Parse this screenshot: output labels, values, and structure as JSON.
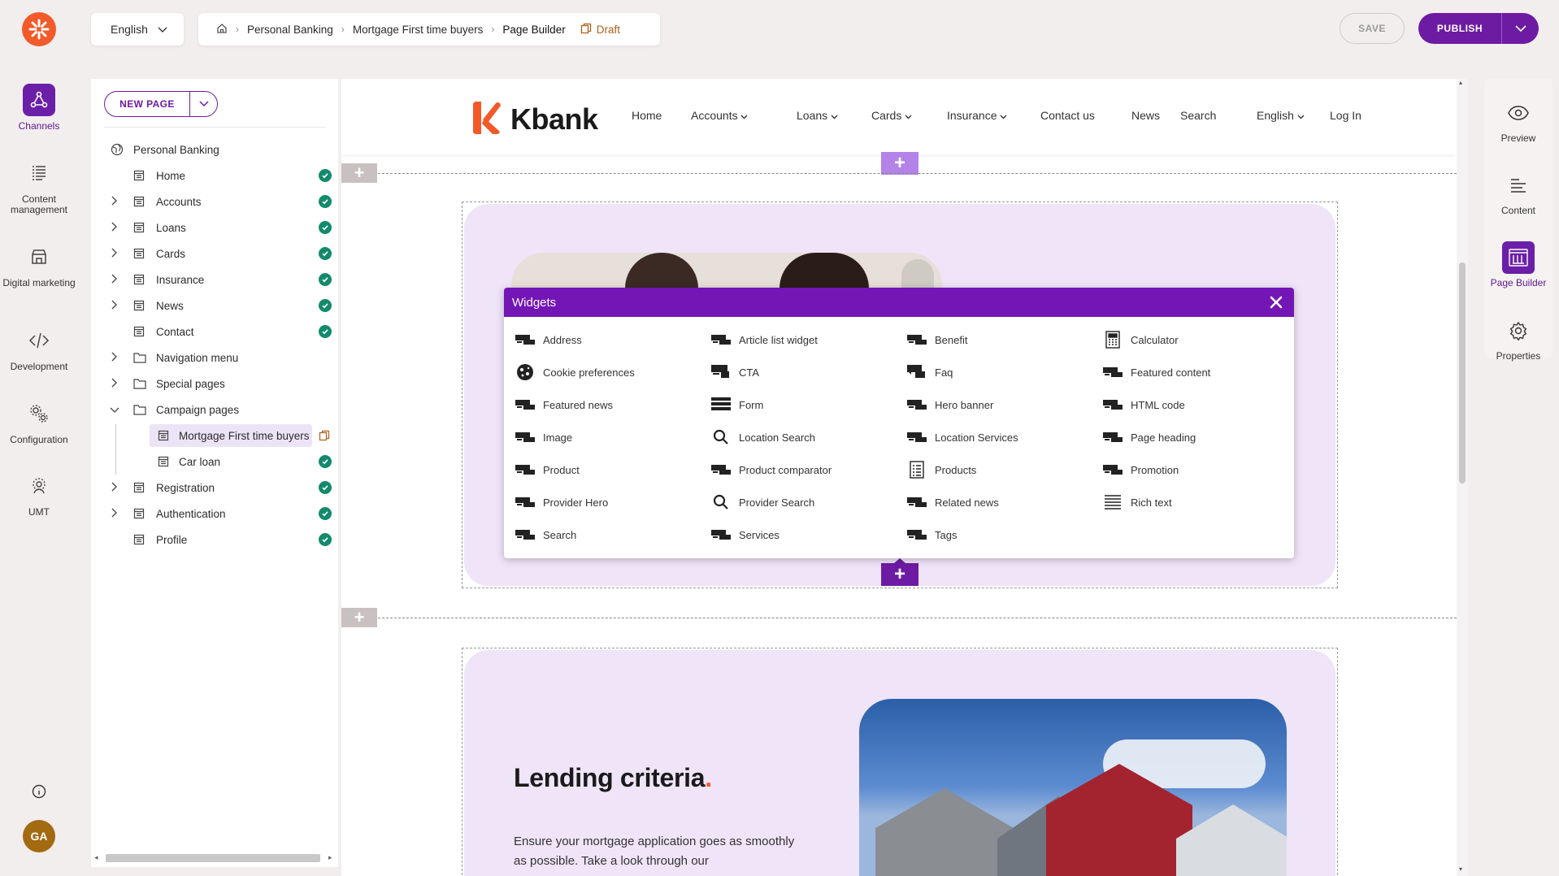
{
  "rail": {
    "items": [
      {
        "label": "Channels",
        "icon": "channels-icon",
        "active": true
      },
      {
        "label": "Content management",
        "icon": "content-management-icon"
      },
      {
        "label": "Digital marketing",
        "icon": "digital-marketing-icon"
      },
      {
        "label": "Development",
        "icon": "code-icon"
      },
      {
        "label": "Configuration",
        "icon": "gears-icon"
      },
      {
        "label": "UMT",
        "icon": "umt-icon"
      }
    ],
    "info_icon": "info-icon",
    "avatar_initials": "GA"
  },
  "topbar": {
    "language": "English",
    "breadcrumb": [
      "Personal Banking",
      "Mortgage First time buyers",
      "Page Builder"
    ],
    "status": "Draft",
    "save_label": "SAVE",
    "publish_label": "PUBLISH"
  },
  "tree": {
    "new_page_label": "NEW PAGE",
    "root": "Personal Banking",
    "items": [
      {
        "label": "Home",
        "expandable": false,
        "published": true
      },
      {
        "label": "Accounts",
        "expandable": true,
        "published": true
      },
      {
        "label": "Loans",
        "expandable": true,
        "published": true
      },
      {
        "label": "Cards",
        "expandable": true,
        "published": true
      },
      {
        "label": "Insurance",
        "expandable": true,
        "published": true
      },
      {
        "label": "News",
        "expandable": true,
        "published": true
      },
      {
        "label": "Contact",
        "expandable": false,
        "published": true
      },
      {
        "label": "Navigation menu",
        "expandable": true,
        "folder": true
      },
      {
        "label": "Special pages",
        "expandable": true,
        "folder": true
      },
      {
        "label": "Campaign pages",
        "expandable": true,
        "expanded": true,
        "folder": true
      },
      {
        "label": "Mortgage First time buyers",
        "child": true,
        "selected": true,
        "draft": true
      },
      {
        "label": "Car loan",
        "child": true,
        "published": true
      },
      {
        "label": "Registration",
        "expandable": true,
        "published": true
      },
      {
        "label": "Authentication",
        "expandable": true,
        "published": true
      },
      {
        "label": "Profile",
        "expandable": false,
        "published": true
      }
    ]
  },
  "site": {
    "brand": "Kbank",
    "brand_color": "#f25a2a",
    "nav": [
      "Home",
      "Accounts",
      "Loans",
      "Cards",
      "Insurance",
      "Contact us",
      "News",
      "Search",
      "English",
      "Log In"
    ],
    "nav_dropdowns": [
      "Accounts",
      "Loans",
      "Cards",
      "Insurance",
      "English"
    ]
  },
  "widgets_popup": {
    "title": "Widgets",
    "items": [
      {
        "label": "Address",
        "icon": "widget-icon"
      },
      {
        "label": "Article list widget",
        "icon": "widget-icon"
      },
      {
        "label": "Benefit",
        "icon": "widget-icon"
      },
      {
        "label": "Calculator",
        "icon": "calculator-icon"
      },
      {
        "label": "Cookie preferences",
        "icon": "cookie-icon"
      },
      {
        "label": "CTA",
        "icon": "cta-icon"
      },
      {
        "label": "Faq",
        "icon": "faq-icon"
      },
      {
        "label": "Featured content",
        "icon": "widget-icon"
      },
      {
        "label": "Featured news",
        "icon": "widget-icon"
      },
      {
        "label": "Form",
        "icon": "form-icon"
      },
      {
        "label": "Hero banner",
        "icon": "widget-icon"
      },
      {
        "label": "HTML code",
        "icon": "widget-icon"
      },
      {
        "label": "Image",
        "icon": "widget-icon"
      },
      {
        "label": "Location Search",
        "icon": "search-icon"
      },
      {
        "label": "Location Services",
        "icon": "widget-icon"
      },
      {
        "label": "Page heading",
        "icon": "widget-icon"
      },
      {
        "label": "Product",
        "icon": "widget-icon"
      },
      {
        "label": "Product comparator",
        "icon": "widget-icon"
      },
      {
        "label": "Products",
        "icon": "list-icon"
      },
      {
        "label": "Promotion",
        "icon": "widget-icon"
      },
      {
        "label": "Provider Hero",
        "icon": "widget-icon"
      },
      {
        "label": "Provider Search",
        "icon": "search-icon"
      },
      {
        "label": "Related news",
        "icon": "widget-icon"
      },
      {
        "label": "Rich text",
        "icon": "rich-text-icon"
      },
      {
        "label": "Search",
        "icon": "widget-icon"
      },
      {
        "label": "Services",
        "icon": "widget-icon"
      },
      {
        "label": "Tags",
        "icon": "widget-icon"
      }
    ]
  },
  "lending": {
    "title": "Lending criteria",
    "title_dot": ".",
    "body": "Ensure your mortgage application goes as smoothly as possible. Take a look through our"
  },
  "right_panel": {
    "items": [
      {
        "label": "Preview",
        "icon": "eye-icon"
      },
      {
        "label": "Content",
        "icon": "content-icon"
      },
      {
        "label": "Page Builder",
        "icon": "page-builder-icon",
        "active": true
      },
      {
        "label": "Properties",
        "icon": "gear-icon"
      }
    ]
  },
  "colors": {
    "accent": "#6e1ba3",
    "popup_header": "#7316b5",
    "published": "#138a6c",
    "draft": "#b0601a",
    "section_bg": "#efe4f8"
  }
}
